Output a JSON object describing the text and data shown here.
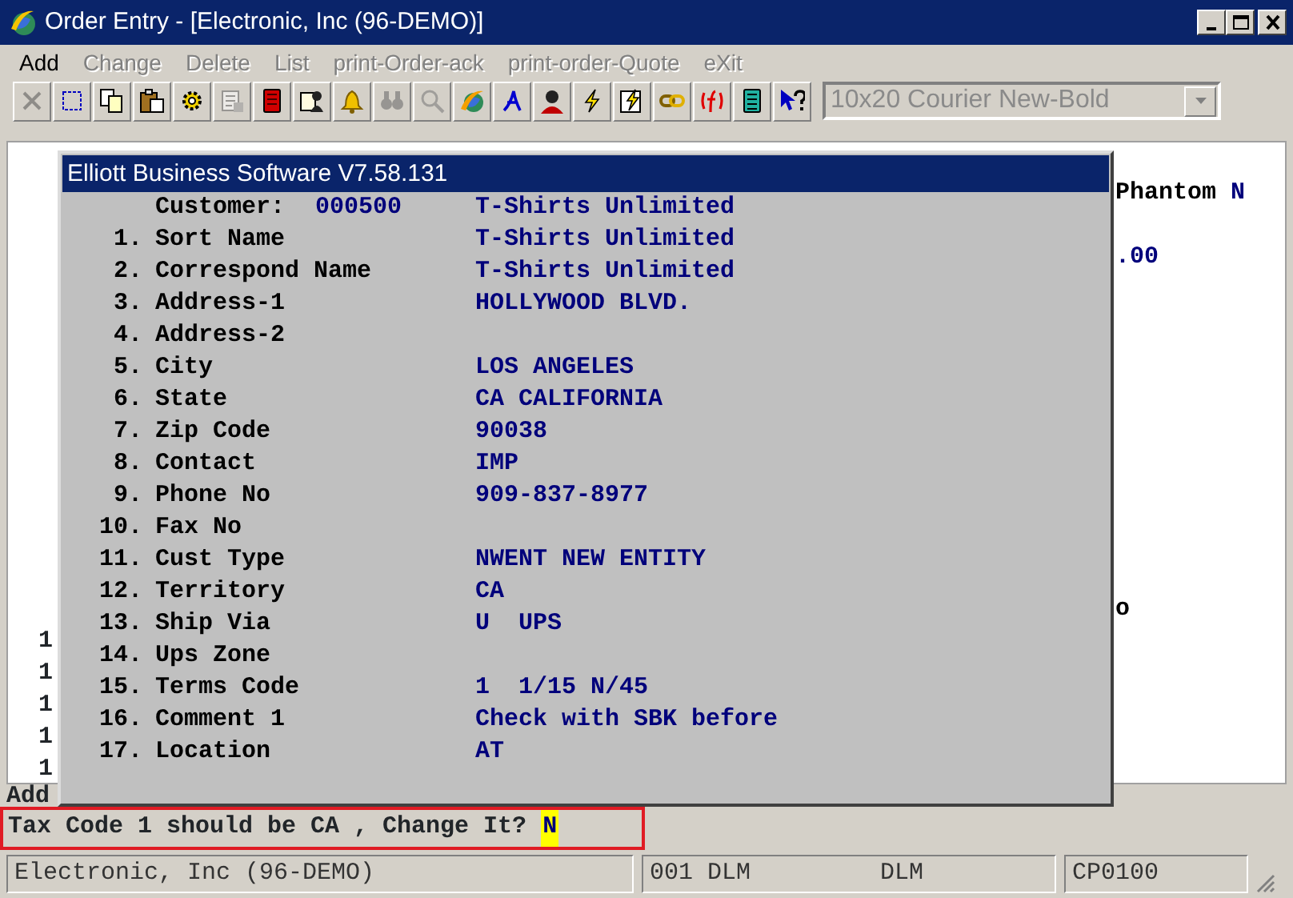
{
  "window": {
    "title": "Order Entry - [Electronic, Inc (96-DEMO)]"
  },
  "menu": [
    {
      "label": "Add",
      "disabled": false
    },
    {
      "label": "Change",
      "disabled": true
    },
    {
      "label": "Delete",
      "disabled": true
    },
    {
      "label": "List",
      "disabled": true
    },
    {
      "label": "print-Order-ack",
      "disabled": true
    },
    {
      "label": "print-order-Quote",
      "disabled": true
    },
    {
      "label": "eXit",
      "disabled": true
    }
  ],
  "toolbar": [
    {
      "kind": "close",
      "disabled": true
    },
    {
      "kind": "select",
      "disabled": false
    },
    {
      "kind": "copy",
      "disabled": false
    },
    {
      "kind": "paste",
      "disabled": false
    },
    {
      "kind": "gear",
      "disabled": false
    },
    {
      "kind": "properties",
      "disabled": true
    },
    {
      "kind": "book",
      "disabled": false
    },
    {
      "kind": "contact",
      "disabled": false
    },
    {
      "kind": "bell",
      "disabled": false
    },
    {
      "kind": "binoculars",
      "disabled": true
    },
    {
      "kind": "search",
      "disabled": true
    },
    {
      "kind": "globe",
      "disabled": false
    },
    {
      "kind": "pen",
      "disabled": false
    },
    {
      "kind": "person",
      "disabled": false
    },
    {
      "kind": "lightning",
      "disabled": false
    },
    {
      "kind": "lightningdoc",
      "disabled": false
    },
    {
      "kind": "link",
      "disabled": false
    },
    {
      "kind": "formula",
      "disabled": false
    },
    {
      "kind": "ledger",
      "disabled": false
    },
    {
      "kind": "help",
      "disabled": false
    }
  ],
  "font_select": {
    "value": "10x20 Courier New-Bold",
    "disabled": true
  },
  "background": {
    "right_lines": [
      [
        {
          "text": "Phantom",
          "color": "#000000"
        },
        {
          "text": "N",
          "color": "#00007b"
        }
      ],
      [
        {
          "text": ".00",
          "color": "#00007b"
        }
      ],
      [
        {
          "text": "o",
          "color": "#000000"
        }
      ]
    ],
    "left_lines": [
      "1",
      "1",
      "1",
      "1",
      "1"
    ],
    "command": "Add"
  },
  "dialog": {
    "title": "Elliott Business Software V7.58.131",
    "customer": {
      "label": "Customer:",
      "code": "000500",
      "name": "T-Shirts Unlimited"
    },
    "fields": [
      {
        "number": "1.",
        "label": "Sort Name",
        "value": "T-Shirts Unlimited"
      },
      {
        "number": "2.",
        "label": "Correspond Name",
        "value": "T-Shirts Unlimited"
      },
      {
        "number": "3.",
        "label": "Address-1",
        "value": "HOLLYWOOD BLVD."
      },
      {
        "number": "4.",
        "label": "Address-2"
      },
      {
        "number": "5.",
        "label": "City",
        "value": "LOS ANGELES"
      },
      {
        "number": "6.",
        "label": "State",
        "value": "CA CALIFORNIA"
      },
      {
        "number": "7.",
        "label": "Zip Code",
        "value": "90038"
      },
      {
        "number": "8.",
        "label": "Contact",
        "value": "IMP"
      },
      {
        "number": "9.",
        "label": "Phone No",
        "value": "909-837-8977"
      },
      {
        "number": "10.",
        "label": "Fax No"
      },
      {
        "number": "11.",
        "label": "Cust Type",
        "value": "NWENT NEW ENTITY"
      },
      {
        "number": "12.",
        "label": "Territory",
        "value": "CA"
      },
      {
        "number": "13.",
        "label": "Ship Via",
        "value": "U  UPS"
      },
      {
        "number": "14.",
        "label": "Ups Zone"
      },
      {
        "number": "15.",
        "label": "Terms Code",
        "value": "1  1/15 N/45"
      },
      {
        "number": "16.",
        "label": "Comment 1",
        "value": "Check with SBK before"
      },
      {
        "number": "17.",
        "label": "Location",
        "value": "AT"
      }
    ]
  },
  "prompt": {
    "text": "Tax Code 1 should be CA , Change It?",
    "answer": "N",
    "highlighted": true
  },
  "status_bar": {
    "company": "Electronic, Inc (96-DEMO)",
    "user": "001 DLM",
    "user_2": "DLM",
    "program": "CP0100"
  }
}
